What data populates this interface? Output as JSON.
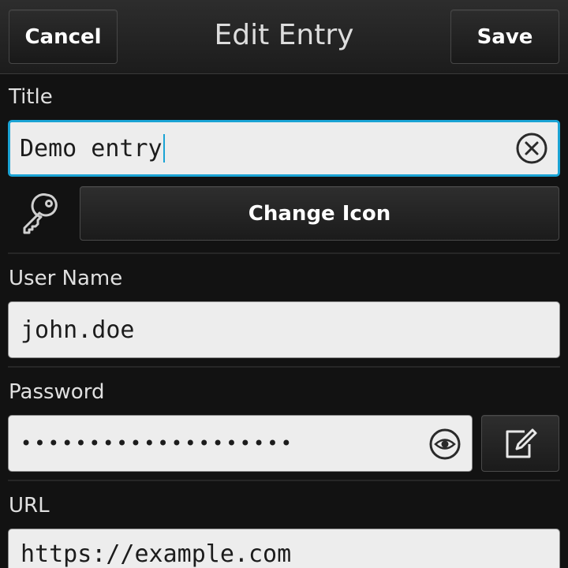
{
  "header": {
    "cancel_label": "Cancel",
    "title": "Edit Entry",
    "save_label": "Save"
  },
  "title_field": {
    "label": "Title",
    "value": "Demo entry",
    "clear_icon": "clear-circle-icon"
  },
  "icon_row": {
    "entry_icon": "key-icon",
    "change_icon_label": "Change Icon"
  },
  "username_field": {
    "label": "User Name",
    "value": "john.doe"
  },
  "password_field": {
    "label": "Password",
    "masked_value": "••••••••••••••••••••",
    "reveal_icon": "eye-icon",
    "generate_icon": "edit-icon"
  },
  "url_field": {
    "label": "URL",
    "value": "https://example.com"
  },
  "colors": {
    "background": "#121212",
    "focus_accent": "#1aa3d4",
    "field_bg": "#ededed"
  }
}
